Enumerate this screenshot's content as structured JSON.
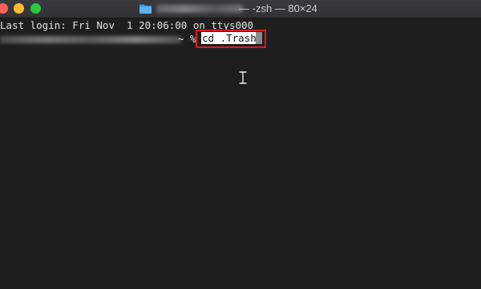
{
  "window": {
    "title_suffix": "— -zsh — 80×24"
  },
  "terminal": {
    "login_line": "Last login: Fri Nov  1 20:06:00 on ttys000",
    "prompt_symbol": "~ %",
    "command": "cd .Trash"
  },
  "colors": {
    "background": "#1e1e1e",
    "highlight_box": "#e0191c"
  },
  "icons": [
    "folder-icon",
    "text-cursor-icon"
  ]
}
